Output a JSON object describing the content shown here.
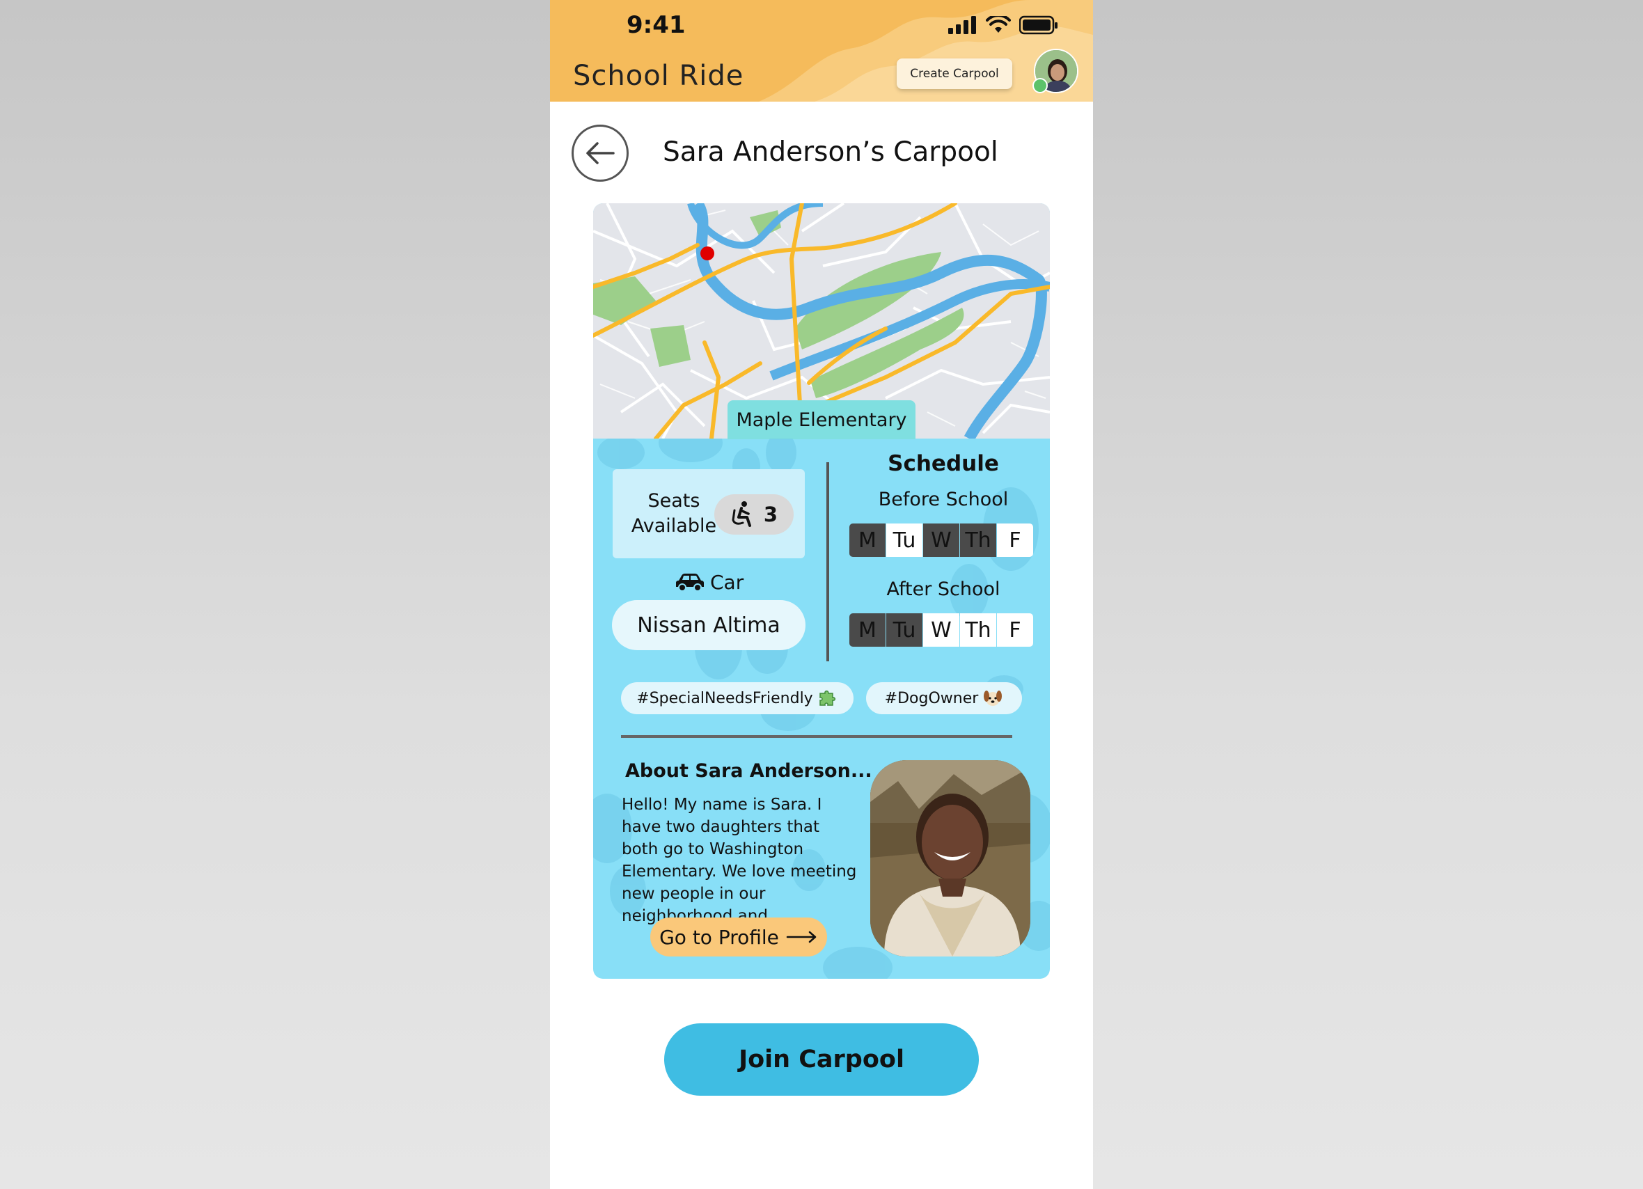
{
  "status_bar": {
    "time": "9:41"
  },
  "header": {
    "app_title": "School Ride",
    "create_button": "Create Carpool"
  },
  "page": {
    "title": "Sara Anderson’s Carpool"
  },
  "map": {
    "school_label": "Maple Elementary"
  },
  "seats": {
    "label": "Seats Available",
    "count": "3"
  },
  "car": {
    "label": "Car",
    "model": "Nissan Altima"
  },
  "schedule": {
    "title": "Schedule",
    "before": {
      "label": "Before School",
      "days": [
        {
          "d": "M",
          "on": true
        },
        {
          "d": "Tu",
          "on": false
        },
        {
          "d": "W",
          "on": true
        },
        {
          "d": "Th",
          "on": true
        },
        {
          "d": "F",
          "on": false
        }
      ]
    },
    "after": {
      "label": "After School",
      "days": [
        {
          "d": "M",
          "on": true
        },
        {
          "d": "Tu",
          "on": true
        },
        {
          "d": "W",
          "on": false
        },
        {
          "d": "Th",
          "on": false
        },
        {
          "d": "F",
          "on": false
        }
      ]
    }
  },
  "tags": [
    "#SpecialNeedsFriendly",
    "#DogOwner"
  ],
  "about": {
    "title": "About Sara Anderson...",
    "text": "Hello! My name is Sara. I have two daughters that both go to Washington Elementary. We love meeting new people in our neighborhood and...",
    "profile_button": "Go to Profile"
  },
  "join_button": "Join Carpool",
  "colors": {
    "header": "#f5bb5b",
    "card": "#88dff7",
    "join": "#3fbde3",
    "profile_button": "#fac87a",
    "map_marker": "#e00000"
  }
}
